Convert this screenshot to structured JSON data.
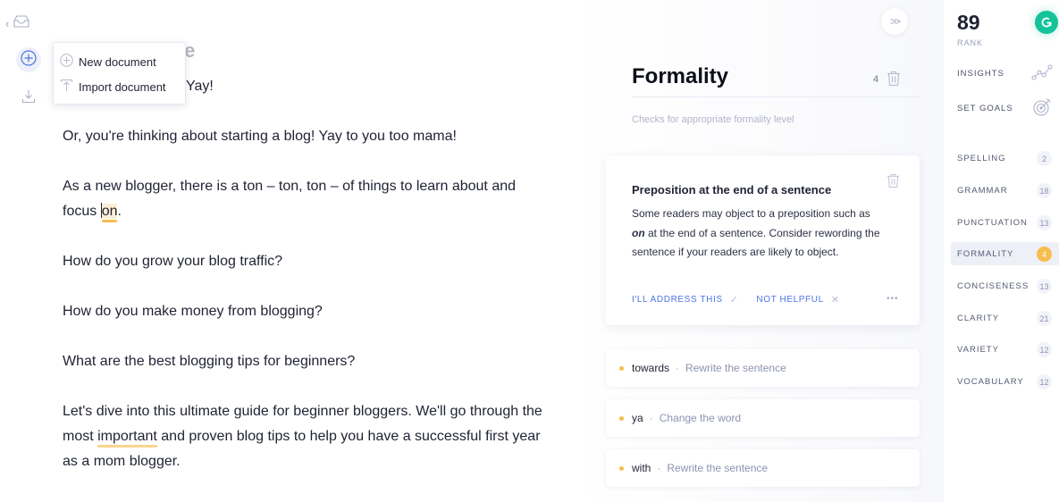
{
  "left_rail": {
    "back_icon": "chevron-left-icon",
    "docs_icon": "inbox-tray-icon",
    "new_icon": "plus-circle-icon",
    "download_icon": "download-icon"
  },
  "dropdown": {
    "items": [
      {
        "label": "New document",
        "icon": "plus-circle-icon"
      },
      {
        "label": "Import document",
        "icon": "upload-icon"
      }
    ]
  },
  "editor": {
    "title_visible": "le",
    "paragraphs": {
      "p1_end": "Yay!",
      "p2": "Or, you're thinking about starting a blog! Yay to you too mama!",
      "p3_before": "As a new blogger, there is a ton – ton, ton – of things to learn about and focus ",
      "p3_flag": "on",
      "p3_after": ".",
      "p4": "How do you grow your blog traffic?",
      "p5": "How do you make money from blogging?",
      "p6": "What are the best blogging tips for beginners?",
      "p7_before": "Let's dive into this ultimate guide for beginner bloggers. We'll go through the most ",
      "p7_flag": "important",
      "p7_after": " and proven blog tips to help you have a successful first year as a mom blogger."
    }
  },
  "panel": {
    "collapse_label": ">>",
    "title": "Formality",
    "count": "4",
    "subtitle": "Checks for appropriate formality level",
    "card": {
      "title": "Preposition at the end of a sentence",
      "body_before": "Some readers may object to a preposition such as ",
      "body_em": "on",
      "body_after": " at the end of a sentence. Consider rewording the sentence if your readers are likely to object.",
      "action_address": "I'LL ADDRESS THIS",
      "action_address_icon": "✓",
      "action_not_helpful": "NOT HELPFUL",
      "action_not_helpful_icon": "✕",
      "more_label": "•••"
    },
    "suggestions": [
      {
        "word": "towards",
        "hint": "Rewrite the sentence"
      },
      {
        "word": "ya",
        "hint": "Change the word"
      },
      {
        "word": "with",
        "hint": "Rewrite the sentence"
      }
    ],
    "separator": "·"
  },
  "sidebar": {
    "score": "89",
    "score_label": "RANK",
    "links": [
      {
        "label": "INSIGHTS",
        "icon": "line-chart-icon"
      },
      {
        "label": "SET GOALS",
        "icon": "target-icon"
      }
    ],
    "categories": [
      {
        "label": "SPELLING",
        "count": "2"
      },
      {
        "label": "GRAMMAR",
        "count": "18"
      },
      {
        "label": "PUNCTUATION",
        "count": "13"
      },
      {
        "label": "FORMALITY",
        "count": "4",
        "active": true
      },
      {
        "label": "CONCISENESS",
        "count": "13"
      },
      {
        "label": "CLARITY",
        "count": "21"
      },
      {
        "label": "VARIETY",
        "count": "12"
      },
      {
        "label": "VOCABULARY",
        "count": "12"
      }
    ]
  },
  "colors": {
    "accent_blue": "#4b74e0",
    "warning_yellow": "#f5be4e",
    "brand_green": "#15c39a"
  }
}
